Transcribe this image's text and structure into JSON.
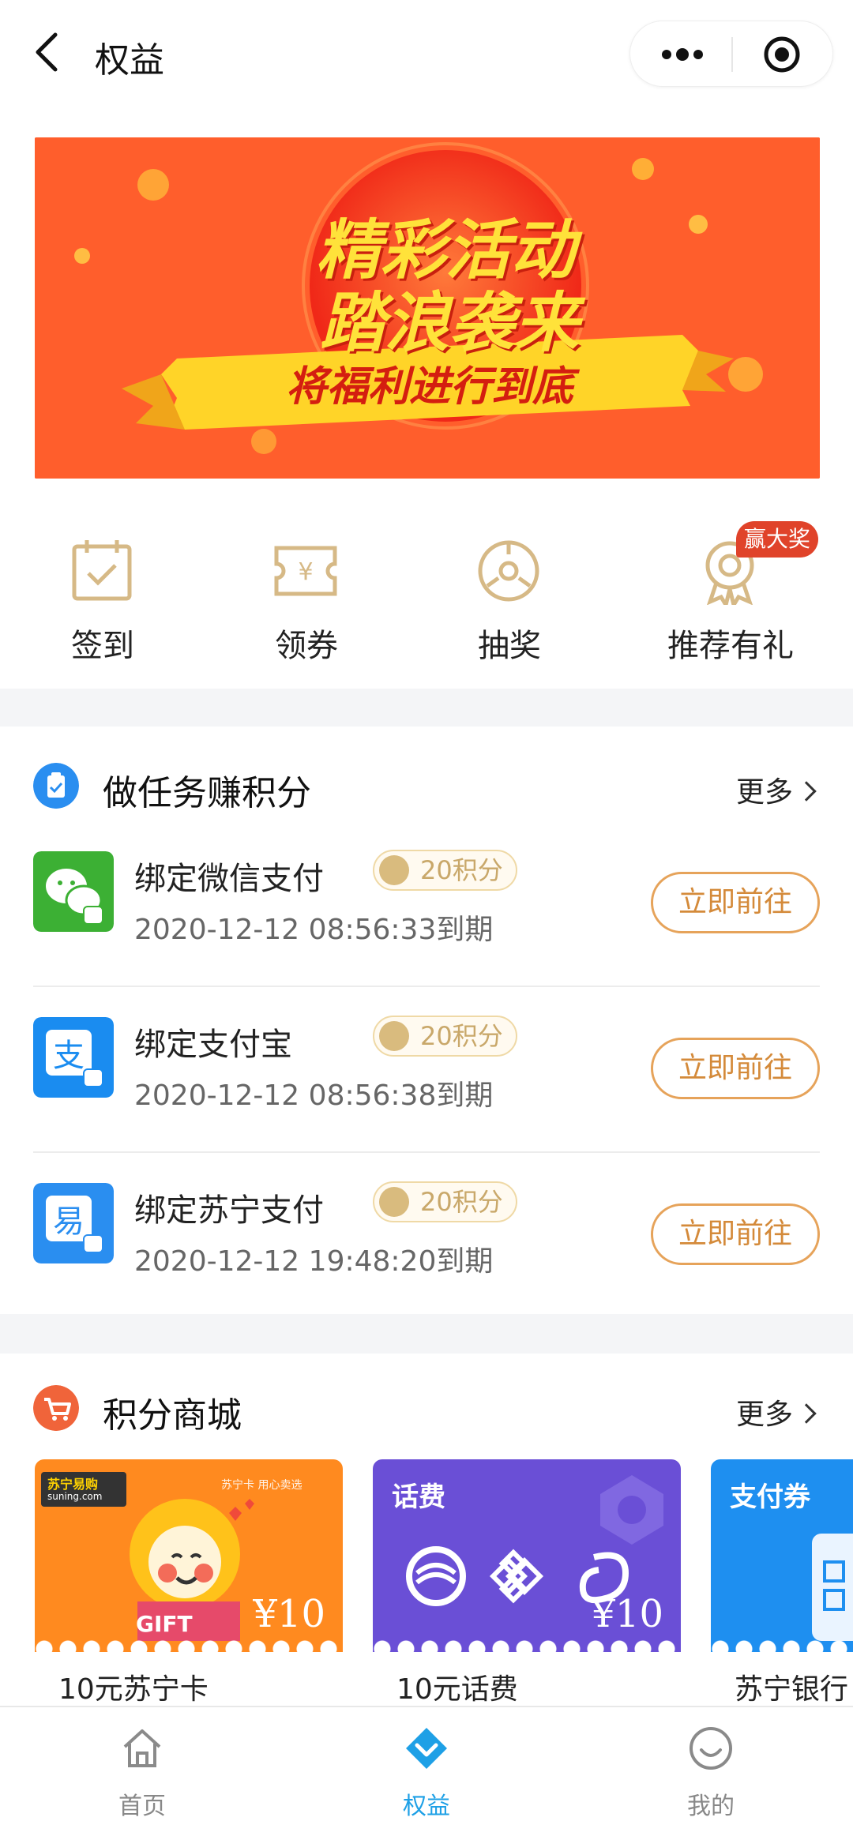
{
  "nav": {
    "title": "权益"
  },
  "banner": {
    "headline_1": "精彩活动",
    "headline_2": "踏浪袭来",
    "ribbon": "将福利进行到底"
  },
  "quick_actions": [
    {
      "label": "签到",
      "icon": "calendar-check-icon"
    },
    {
      "label": "领券",
      "icon": "ticket-yen-icon"
    },
    {
      "label": "抽奖",
      "icon": "lottery-wheel-icon"
    },
    {
      "label": "推荐有礼",
      "icon": "medal-icon",
      "badge": "赢大奖"
    }
  ],
  "tasks_section": {
    "title": "做任务赚积分",
    "more": "更多",
    "items": [
      {
        "name": "绑定微信支付",
        "points": "20积分",
        "expires": "2020-12-12 08:56:33到期",
        "button": "立即前往",
        "icon": "wechat-pay-icon",
        "icon_color": "#3cb034"
      },
      {
        "name": "绑定支付宝",
        "points": "20积分",
        "expires": "2020-12-12 08:56:38到期",
        "button": "立即前往",
        "icon": "alipay-icon",
        "icon_color": "#1a8cf0"
      },
      {
        "name": "绑定苏宁支付",
        "points": "20积分",
        "expires": "2020-12-12 19:48:20到期",
        "button": "立即前往",
        "icon": "suning-pay-icon",
        "icon_color": "#2a8ef0"
      }
    ]
  },
  "mall_section": {
    "title": "积分商城",
    "more": "更多",
    "items": [
      {
        "name": "10元苏宁卡",
        "price": "¥10",
        "tag": "",
        "logo_text": "苏宁易购",
        "logo_sub": "suning.com",
        "slogan": "苏宁卡 用心卖选",
        "gift_text": "GIFT",
        "bg": "#ff8a1f"
      },
      {
        "name": "10元话费",
        "price": "¥10",
        "tag": "话费",
        "bg": "#6a4fd6"
      },
      {
        "name": "苏宁银行",
        "price": "",
        "tag": "支付券",
        "bg": "#1e8ff0"
      }
    ]
  },
  "tabbar": [
    {
      "label": "首页",
      "icon": "home-icon",
      "active": false
    },
    {
      "label": "权益",
      "icon": "diamond-icon",
      "active": true
    },
    {
      "label": "我的",
      "icon": "smile-face-icon",
      "active": false
    }
  ],
  "colors": {
    "accent_blue": "#1ea0e6",
    "button_orange": "#e6a35a",
    "gold": "#c9a86a"
  }
}
